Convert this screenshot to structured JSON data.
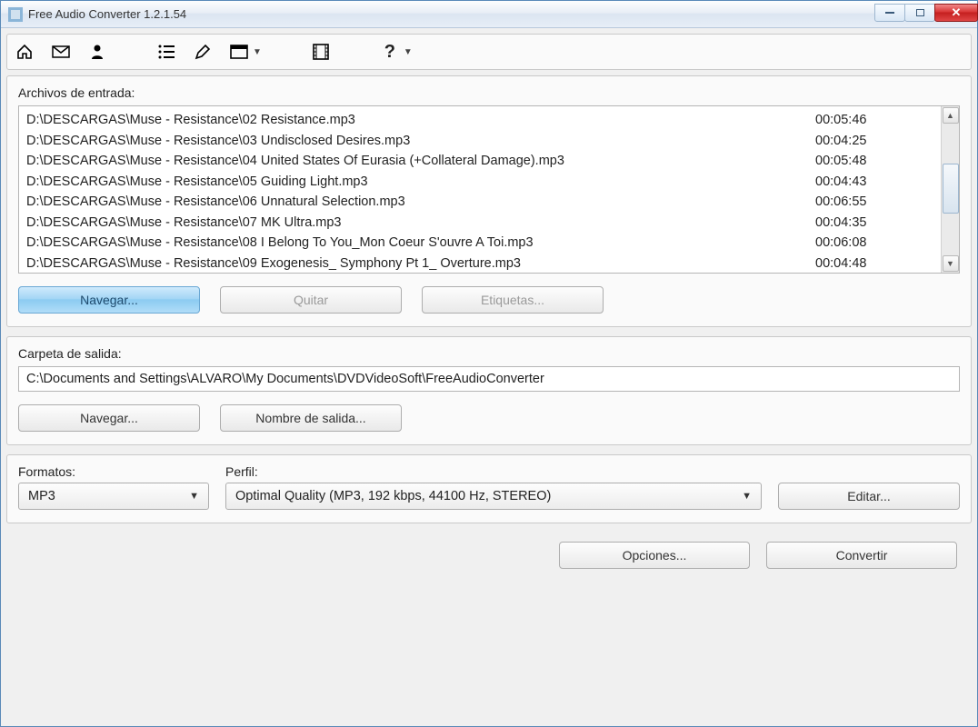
{
  "window": {
    "title": "Free Audio Converter 1.2.1.54"
  },
  "input_section": {
    "label": "Archivos de entrada:",
    "browse": "Navegar...",
    "remove": "Quitar",
    "tags": "Etiquetas...",
    "files": [
      {
        "name": "D:\\DESCARGAS\\Muse - Resistance\\02 Resistance.mp3",
        "duration": "00:05:46"
      },
      {
        "name": "D:\\DESCARGAS\\Muse - Resistance\\03 Undisclosed Desires.mp3",
        "duration": "00:04:25"
      },
      {
        "name": "D:\\DESCARGAS\\Muse - Resistance\\04 United States Of Eurasia (+Collateral Damage).mp3",
        "duration": "00:05:48"
      },
      {
        "name": "D:\\DESCARGAS\\Muse - Resistance\\05 Guiding Light.mp3",
        "duration": "00:04:43"
      },
      {
        "name": "D:\\DESCARGAS\\Muse - Resistance\\06 Unnatural Selection.mp3",
        "duration": "00:06:55"
      },
      {
        "name": "D:\\DESCARGAS\\Muse - Resistance\\07 MK Ultra.mp3",
        "duration": "00:04:35"
      },
      {
        "name": "D:\\DESCARGAS\\Muse - Resistance\\08 I Belong To You_Mon Coeur S'ouvre A Toi.mp3",
        "duration": "00:06:08"
      },
      {
        "name": "D:\\DESCARGAS\\Muse - Resistance\\09 Exogenesis_ Symphony Pt 1_ Overture.mp3",
        "duration": "00:04:48"
      }
    ]
  },
  "output_section": {
    "label": "Carpeta de salida:",
    "path": "C:\\Documents and Settings\\ALVARO\\My Documents\\DVDVideoSoft\\FreeAudioConverter",
    "browse": "Navegar...",
    "output_name": "Nombre de salida..."
  },
  "format_section": {
    "format_label": "Formatos:",
    "profile_label": "Perfil:",
    "format_value": "MP3",
    "profile_value": "Optimal Quality (MP3, 192 kbps, 44100 Hz, STEREO)",
    "edit": "Editar..."
  },
  "footer": {
    "options": "Opciones...",
    "convert": "Convertir"
  }
}
